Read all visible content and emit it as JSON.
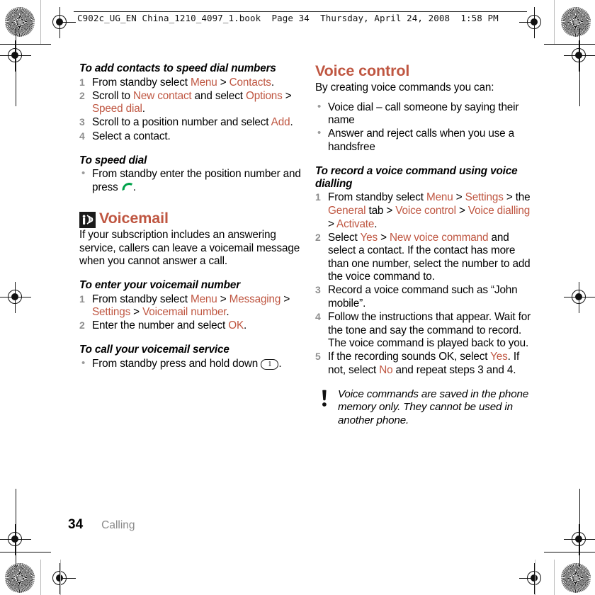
{
  "print_marks": {
    "header_slug": "C902c_UG_EN China_1210_4097_1.book  Page 34  Thursday, April 24, 2008  1:58 PM"
  },
  "colors": {
    "accent": "#bf5641",
    "step_number": "#8e8e8e",
    "bullet": "#9b9b9b",
    "chapter": "#8a8a8a",
    "call_icon_green": "#00a24a"
  },
  "left_column": {
    "proc1": {
      "title": "To add contacts to speed dial numbers",
      "steps": [
        {
          "parts": [
            {
              "t": "From standby select ",
              "hl": false
            },
            {
              "t": "Menu",
              "hl": true
            },
            {
              "t": " > ",
              "hl": false
            },
            {
              "t": "Contacts",
              "hl": true
            },
            {
              "t": ".",
              "hl": false
            }
          ]
        },
        {
          "parts": [
            {
              "t": "Scroll to ",
              "hl": false
            },
            {
              "t": "New contact",
              "hl": true
            },
            {
              "t": " and select ",
              "hl": false
            },
            {
              "t": "Options",
              "hl": true
            },
            {
              "t": " > ",
              "hl": false
            },
            {
              "t": "Speed dial",
              "hl": true
            },
            {
              "t": ".",
              "hl": false
            }
          ]
        },
        {
          "parts": [
            {
              "t": "Scroll to a position number and select ",
              "hl": false
            },
            {
              "t": "Add",
              "hl": true
            },
            {
              "t": ".",
              "hl": false
            }
          ]
        },
        {
          "parts": [
            {
              "t": "Select a contact.",
              "hl": false
            }
          ]
        }
      ]
    },
    "proc2": {
      "title": "To speed dial",
      "bullet_before": "From standby enter the position number and press ",
      "bullet_icon": "call-icon",
      "bullet_after": "."
    },
    "section": {
      "icon": "voicemail-icon",
      "title": "Voicemail",
      "body": "If your subscription includes an answering service, callers can leave a voicemail message when you cannot answer a call."
    },
    "proc3": {
      "title": "To enter your voicemail number",
      "steps": [
        {
          "parts": [
            {
              "t": "From standby select ",
              "hl": false
            },
            {
              "t": "Menu",
              "hl": true
            },
            {
              "t": " > ",
              "hl": false
            },
            {
              "t": "Messaging",
              "hl": true
            },
            {
              "t": " > ",
              "hl": false
            },
            {
              "t": "Settings",
              "hl": true
            },
            {
              "t": " > ",
              "hl": false
            },
            {
              "t": "Voicemail number",
              "hl": true
            },
            {
              "t": ".",
              "hl": false
            }
          ]
        },
        {
          "parts": [
            {
              "t": "Enter the number and select ",
              "hl": false
            },
            {
              "t": "OK",
              "hl": true
            },
            {
              "t": ".",
              "hl": false
            }
          ]
        }
      ]
    },
    "proc4": {
      "title": "To call your voicemail service",
      "bullet_before": "From standby press and hold down ",
      "bullet_key_label": "1",
      "bullet_after": "."
    }
  },
  "right_column": {
    "section": {
      "title": "Voice control",
      "intro": "By creating voice commands you can:",
      "bullets": [
        "Voice dial – call someone by saying their name",
        "Answer and reject calls when you use a handsfree"
      ]
    },
    "proc1": {
      "title": "To record a voice command using voice dialling",
      "steps": [
        {
          "parts": [
            {
              "t": "From standby select ",
              "hl": false
            },
            {
              "t": "Menu",
              "hl": true
            },
            {
              "t": " > ",
              "hl": false
            },
            {
              "t": "Settings",
              "hl": true
            },
            {
              "t": " > the ",
              "hl": false
            },
            {
              "t": "General",
              "hl": true
            },
            {
              "t": " tab > ",
              "hl": false
            },
            {
              "t": "Voice control",
              "hl": true
            },
            {
              "t": " > ",
              "hl": false
            },
            {
              "t": "Voice dialling",
              "hl": true
            },
            {
              "t": " > ",
              "hl": false
            },
            {
              "t": "Activate",
              "hl": true
            },
            {
              "t": ".",
              "hl": false
            }
          ]
        },
        {
          "parts": [
            {
              "t": "Select ",
              "hl": false
            },
            {
              "t": "Yes",
              "hl": true
            },
            {
              "t": " > ",
              "hl": false
            },
            {
              "t": "New voice command",
              "hl": true
            },
            {
              "t": " and select a contact. If the contact has more than one number, select the number to add the voice command to.",
              "hl": false
            }
          ]
        },
        {
          "parts": [
            {
              "t": "Record a voice command such as “John mobile”.",
              "hl": false
            }
          ]
        },
        {
          "parts": [
            {
              "t": "Follow the instructions that appear. Wait for the tone and say the command to record. The voice command is played back to you.",
              "hl": false
            }
          ]
        },
        {
          "parts": [
            {
              "t": "If the recording sounds OK, select ",
              "hl": false
            },
            {
              "t": "Yes",
              "hl": true
            },
            {
              "t": ". If not, select ",
              "hl": false
            },
            {
              "t": "No",
              "hl": true
            },
            {
              "t": " and repeat steps 3 and 4.",
              "hl": false
            }
          ]
        }
      ]
    },
    "note": {
      "icon": "exclamation-icon",
      "text": "Voice commands are saved in the phone memory only. They cannot be used in another phone."
    }
  },
  "footer": {
    "page_number": "34",
    "chapter": "Calling"
  }
}
